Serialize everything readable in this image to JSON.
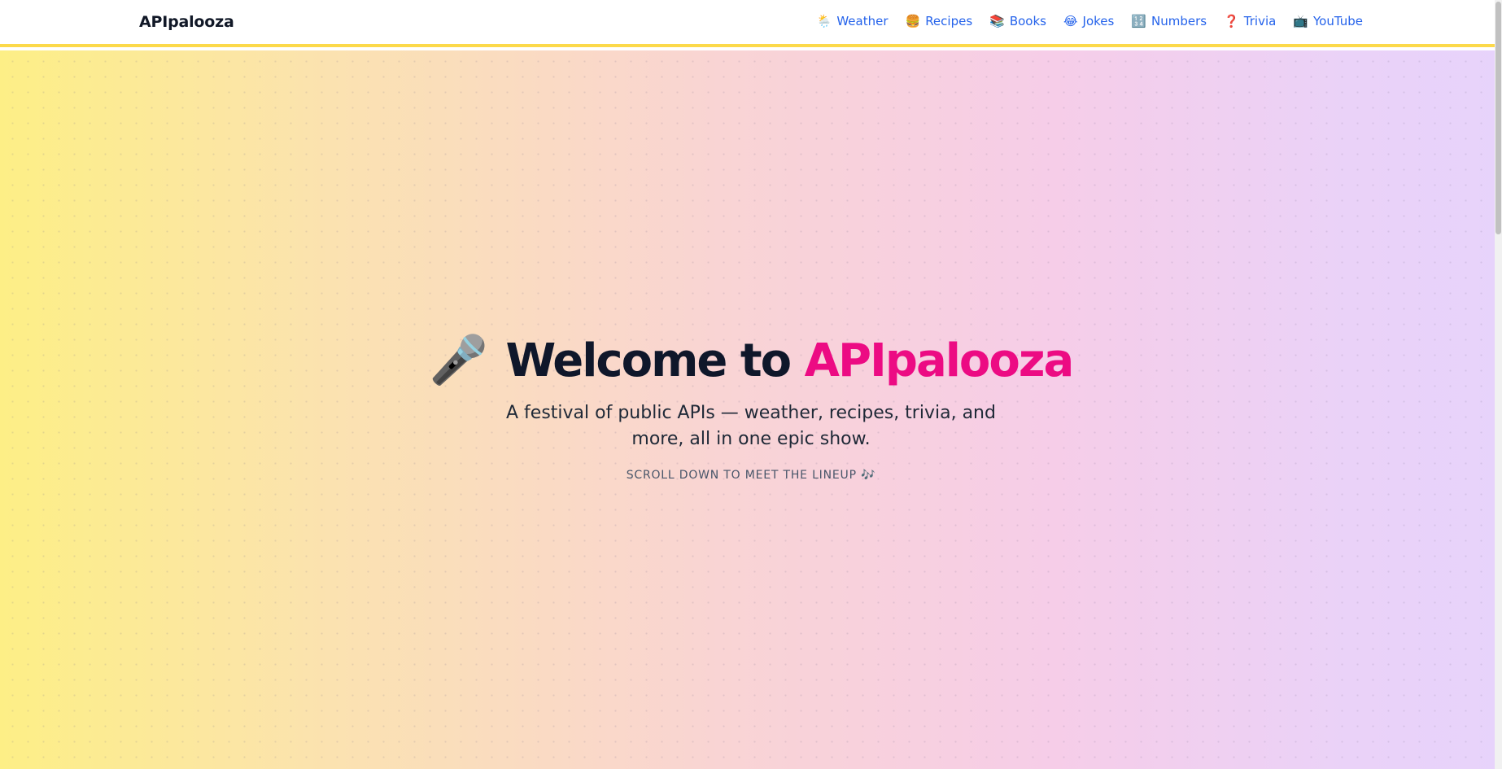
{
  "navbar": {
    "brand": "APIpalooza",
    "links": [
      {
        "emoji": "🌦️",
        "label": "Weather"
      },
      {
        "emoji": "🍔",
        "label": "Recipes"
      },
      {
        "emoji": "📚",
        "label": "Books"
      },
      {
        "emoji": "😂",
        "label": "Jokes"
      },
      {
        "emoji": "🔢",
        "label": "Numbers"
      },
      {
        "emoji": "❓",
        "label": "Trivia"
      },
      {
        "emoji": "📺",
        "label": "YouTube"
      }
    ]
  },
  "hero": {
    "mic_emoji": "🎤",
    "title_prefix": "Welcome to",
    "title_brand": "APIpalooza",
    "subtitle": "A festival of public APIs — weather, recipes, trivia, and more, all in one epic show.",
    "scroll_hint": "SCROLL DOWN TO MEET THE LINEUP 🎶"
  },
  "colors": {
    "accent": "#ec0b83",
    "link": "#2563eb",
    "nav_border": "#fcd94a",
    "title": "#0f172a"
  },
  "icons": {
    "mic": "microphone-icon"
  }
}
